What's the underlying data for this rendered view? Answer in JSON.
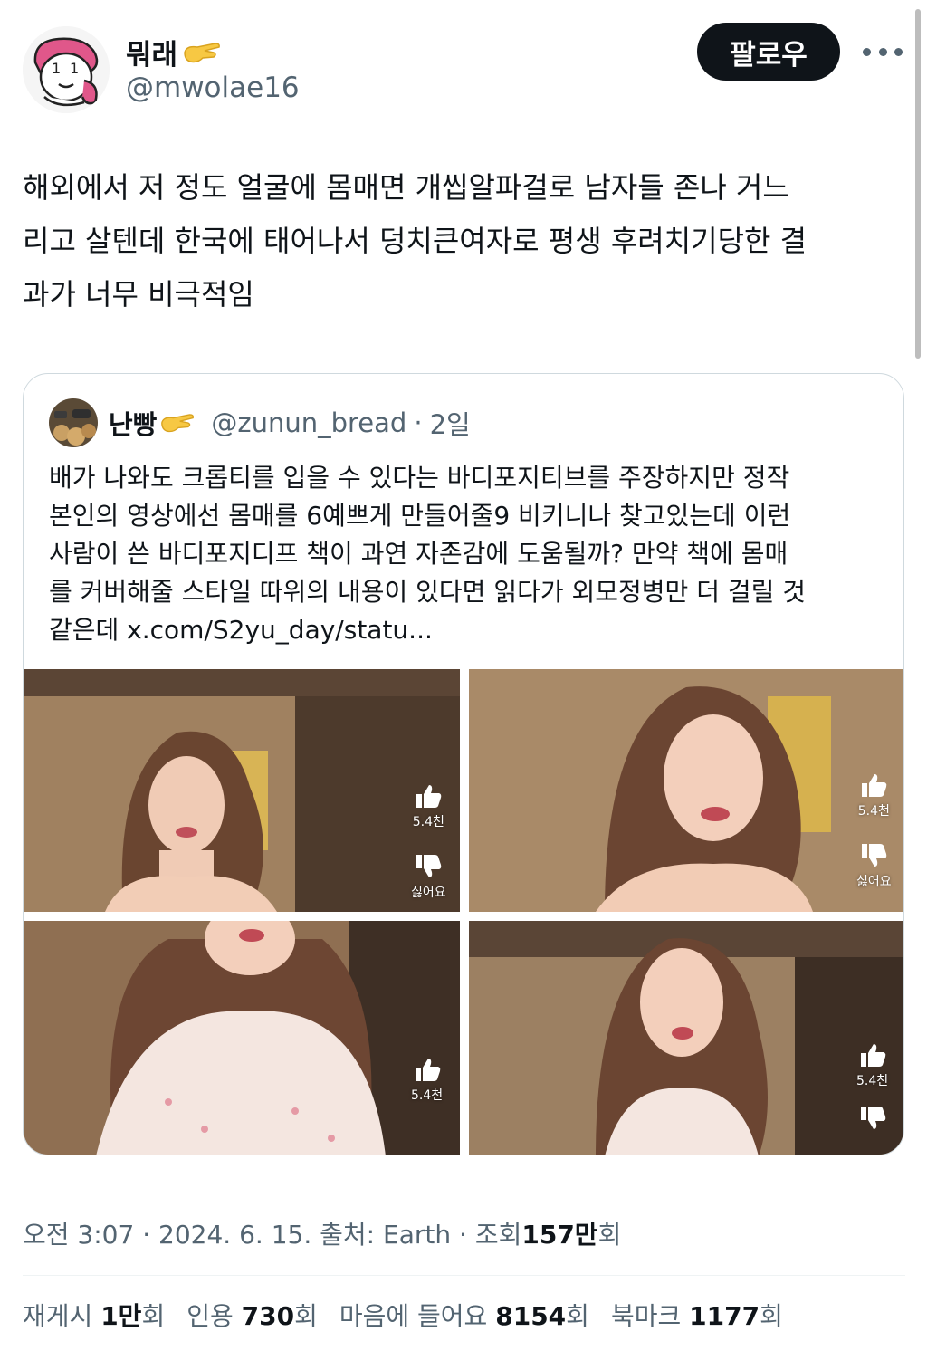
{
  "author": {
    "name": "뭐래",
    "handle": "@mwolae16",
    "emoji": "pinching-hand-emoji"
  },
  "follow_label": "팔로우",
  "tweet_text": "해외에서 저 정도 얼굴에 몸매면 개씹알파걸로 남자들 존나 거느\n리고 살텐데 한국에 태어나서 덩치큰여자로 평생 후려치기당한 결\n과가 너무 비극적임",
  "quote": {
    "name": "난빵",
    "handle": "@zunun_bread",
    "separator": "·",
    "date": "2일",
    "text": "배가 나와도 크롭티를 입을 수 있다는 바디포지티브를 주장하지만 정작\n본인의 영상에선 몸매를 6예쁘게 만들어줄9 비키니나 찾고있는데 이런\n사람이 쓴 바디포지디프 책이 과연 자존감에 도움될까? 만약 책에 몸매\n를 커버해줄 스타일 따위의 내용이 있다면 읽다가 외모정병만 더 걸릴 것\n같은데 x.com/S2yu_day/statu...",
    "media": [
      {
        "like_count": "5.4천",
        "dislike_label": "싫어요"
      },
      {
        "like_count": "5.4천",
        "dislike_label": "싫어요"
      },
      {
        "like_count": "5.4천"
      },
      {
        "like_count": "5.4천"
      }
    ]
  },
  "meta": {
    "time": "오전 3:07",
    "sep1": "·",
    "date": "2024. 6. 15.",
    "source_label": "출처:",
    "source": "Earth",
    "sep2": "·",
    "views_label": "조회",
    "views_count": "157만",
    "views_unit": "회"
  },
  "stats": {
    "retweets_label": "재게시",
    "retweets_count": "1만",
    "retweets_unit": "회",
    "quotes_label": "인용",
    "quotes_count": "730",
    "quotes_unit": "회",
    "likes_label": "마음에 들어요",
    "likes_count": "8154",
    "likes_unit": "회",
    "bookmarks_label": "북마크",
    "bookmarks_count": "1177",
    "bookmarks_unit": "회"
  },
  "colors": {
    "text_primary": "#0f1419",
    "text_secondary": "#536471",
    "border": "#cfd9de",
    "follow_bg": "#0f1419"
  }
}
